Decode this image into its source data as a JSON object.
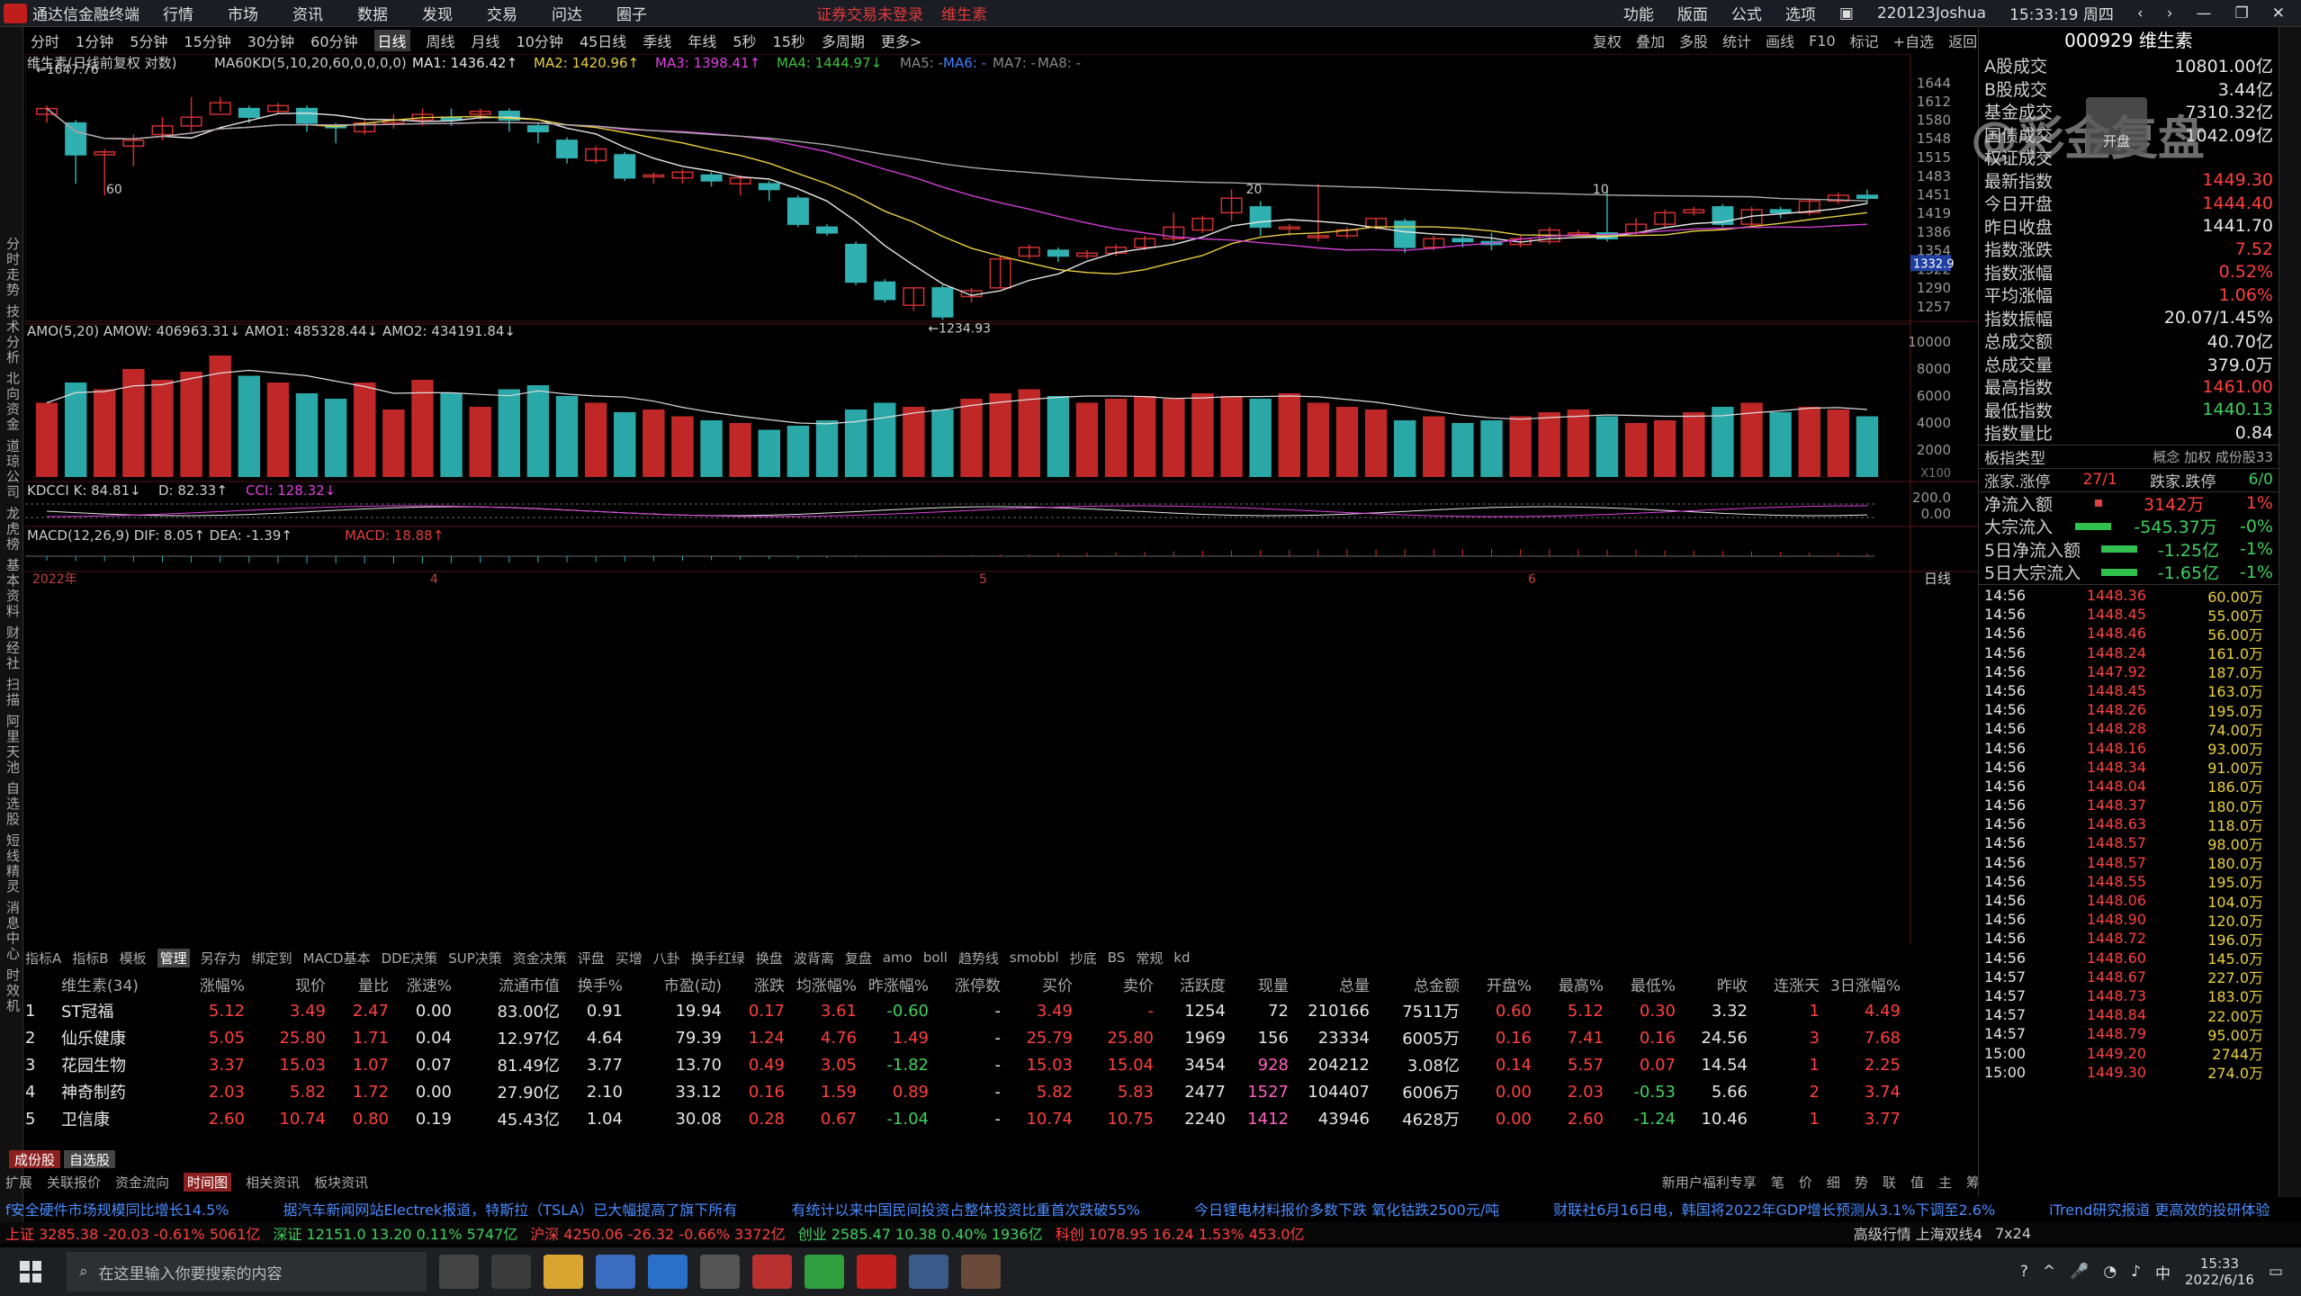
{
  "menubar": {
    "app_name": "通达信金融终端",
    "items": [
      "行情",
      "市场",
      "资讯",
      "数据",
      "发现",
      "交易",
      "问达",
      "圈子"
    ],
    "warning": "证券交易未登录",
    "stock": "维生素",
    "right_items": [
      "功能",
      "版面",
      "公式",
      "选项"
    ],
    "user": "220123Joshua",
    "time": "15:33:19 周四"
  },
  "periodbar": {
    "items": [
      "分时",
      "1分钟",
      "5分钟",
      "15分钟",
      "30分钟",
      "60分钟",
      "日线",
      "周线",
      "月线",
      "10分钟",
      "45日线",
      "季线",
      "年线",
      "5秒",
      "15秒",
      "多周期",
      "更多>"
    ],
    "selected": "日线",
    "tools": [
      "复权",
      "叠加",
      "多股",
      "统计",
      "画线",
      "F10",
      "标记",
      "+自选",
      "返回"
    ]
  },
  "leftstrip": {
    "text": "分时走势 技术分析 北向资金 道琼公司 龙虎榜 基本资料 财经社 扫描 阿里天池 自选股 短线精灵 消息中心 时效机"
  },
  "chart": {
    "legend_main": "维生素(日线前复权 对数)",
    "ma_label": "MA60KD(5,10,20,60,0,0,0,0)",
    "ma1": "MA1: 1436.42↑",
    "ma2": "MA2: 1420.96↑",
    "ma3": "MA3: 1398.41↑",
    "ma4": "MA4: 1444.97↓",
    "ma5": "MA5: -",
    "ma6": "MA6: -",
    "ma7": "MA7: -",
    "ma8": "MA8: -",
    "price_axis": [
      "1644",
      "1612",
      "1580",
      "1548",
      "1515",
      "1483",
      "1451",
      "1419",
      "1386",
      "1354",
      "1322",
      "1290",
      "1257"
    ],
    "high_label": "←1647.76",
    "low_label": "←1234.93",
    "current_marker": "1332.9",
    "ann_60": "60",
    "ann_20": "20",
    "ann_10": "10",
    "vol_legend": "AMO(5,20)  AMOW: 406963.31↓  AMO1: 485328.44↓  AMO2: 434191.84↓",
    "vol_axis": [
      "10000",
      "8000",
      "6000",
      "4000",
      "2000",
      "X100"
    ],
    "kdcci_legend_k": "KDCCI  K: 84.81↓",
    "kdcci_legend_d": "D: 82.33↑",
    "kdcci_legend_cci": "CCI: 128.32↓",
    "kdcci_axis": [
      "200.0",
      "0.00"
    ],
    "macd_legend": "MACD(12,26,9)  DIF: 8.05↑  DEA: -1.39↑",
    "macd_val": "MACD: 18.88↑",
    "date_labels": [
      "2022年",
      "4",
      "5",
      "6"
    ],
    "date_axis_right": "日线"
  },
  "chart_data": {
    "type": "candlestick",
    "title": "维生素(日线前复权 对数)",
    "ylim": [
      1234.93,
      1647.76
    ],
    "candles": [
      [
        1590,
        1600,
        1575,
        1605
      ],
      [
        1575,
        1520,
        1470,
        1580
      ],
      [
        1520,
        1525,
        1450,
        1530
      ],
      [
        1535,
        1545,
        1500,
        1555
      ],
      [
        1555,
        1570,
        1545,
        1585
      ],
      [
        1570,
        1585,
        1560,
        1620
      ],
      [
        1590,
        1610,
        1595,
        1620
      ],
      [
        1600,
        1585,
        1575,
        1605
      ],
      [
        1595,
        1605,
        1590,
        1610
      ],
      [
        1600,
        1575,
        1560,
        1605
      ],
      [
        1570,
        1568,
        1540,
        1575
      ],
      [
        1560,
        1575,
        1555,
        1580
      ],
      [
        1575,
        1580,
        1565,
        1590
      ],
      [
        1580,
        1590,
        1570,
        1600
      ],
      [
        1585,
        1580,
        1570,
        1600
      ],
      [
        1590,
        1595,
        1580,
        1600
      ],
      [
        1595,
        1580,
        1560,
        1600
      ],
      [
        1570,
        1560,
        1540,
        1575
      ],
      [
        1545,
        1515,
        1505,
        1550
      ],
      [
        1510,
        1530,
        1505,
        1535
      ],
      [
        1520,
        1480,
        1475,
        1525
      ],
      [
        1485,
        1485,
        1470,
        1490
      ],
      [
        1480,
        1490,
        1470,
        1495
      ],
      [
        1485,
        1475,
        1465,
        1490
      ],
      [
        1470,
        1480,
        1450,
        1485
      ],
      [
        1470,
        1460,
        1440,
        1475
      ],
      [
        1445,
        1400,
        1395,
        1450
      ],
      [
        1395,
        1385,
        1380,
        1400
      ],
      [
        1365,
        1300,
        1295,
        1370
      ],
      [
        1300,
        1270,
        1265,
        1305
      ],
      [
        1260,
        1290,
        1250,
        1290
      ],
      [
        1290,
        1240,
        1235,
        1295
      ],
      [
        1275,
        1285,
        1265,
        1290
      ],
      [
        1290,
        1340,
        1290,
        1345
      ],
      [
        1345,
        1360,
        1340,
        1365
      ],
      [
        1355,
        1345,
        1335,
        1360
      ],
      [
        1345,
        1350,
        1340,
        1355
      ],
      [
        1350,
        1360,
        1345,
        1365
      ],
      [
        1360,
        1375,
        1355,
        1380
      ],
      [
        1375,
        1395,
        1370,
        1420
      ],
      [
        1390,
        1410,
        1385,
        1415
      ],
      [
        1420,
        1445,
        1405,
        1460
      ],
      [
        1430,
        1395,
        1380,
        1440
      ],
      [
        1395,
        1395,
        1380,
        1400
      ],
      [
        1380,
        1380,
        1370,
        1470
      ],
      [
        1380,
        1390,
        1375,
        1395
      ],
      [
        1395,
        1410,
        1390,
        1410
      ],
      [
        1405,
        1360,
        1350,
        1410
      ],
      [
        1360,
        1375,
        1355,
        1380
      ],
      [
        1375,
        1370,
        1360,
        1380
      ],
      [
        1370,
        1365,
        1355,
        1385
      ],
      [
        1365,
        1375,
        1360,
        1380
      ],
      [
        1370,
        1390,
        1365,
        1395
      ],
      [
        1385,
        1385,
        1380,
        1390
      ],
      [
        1385,
        1375,
        1370,
        1460
      ],
      [
        1385,
        1400,
        1380,
        1410
      ],
      [
        1400,
        1420,
        1395,
        1425
      ],
      [
        1420,
        1425,
        1415,
        1430
      ],
      [
        1430,
        1400,
        1395,
        1435
      ],
      [
        1400,
        1425,
        1395,
        1430
      ],
      [
        1425,
        1420,
        1410,
        1430
      ],
      [
        1420,
        1440,
        1415,
        1445
      ],
      [
        1440,
        1450,
        1435,
        1455
      ],
      [
        1450,
        1445,
        1435,
        1460
      ]
    ],
    "volume": [
      55,
      70,
      65,
      80,
      72,
      78,
      90,
      75,
      70,
      62,
      58,
      70,
      50,
      72,
      62,
      52,
      65,
      68,
      60,
      55,
      48,
      50,
      45,
      42,
      40,
      35,
      38,
      42,
      50,
      55,
      52,
      50,
      58,
      62,
      65,
      60,
      55,
      58,
      60,
      58,
      62,
      60,
      58,
      62,
      55,
      52,
      50,
      42,
      45,
      40,
      42,
      45,
      48,
      50,
      45,
      40,
      42,
      48,
      52,
      55,
      48,
      52,
      50,
      45
    ],
    "volume_colors": "rise=red,fall=teal"
  },
  "indic_tabs": [
    "指标A",
    "指标B",
    "模板",
    "管理",
    "另存为",
    "绑定到",
    "MACD基本",
    "DDE决策",
    "SUP决策",
    "资金决策",
    "评盘",
    "买增",
    "八卦",
    "换手红绿",
    "换盘",
    "波背离",
    "复盘",
    "amo",
    "boll",
    "趋势线",
    "smobbl",
    "抄底",
    "BS",
    "常规",
    "kd"
  ],
  "indic_selected": "管理",
  "table": {
    "group": "维生素(34)",
    "headers": [
      "",
      "维生素(34)",
      "涨幅%",
      "现价",
      "量比",
      "涨速%",
      "流通市值",
      "换手%",
      "市盈(动)",
      "涨跌",
      "均涨幅%",
      "昨涨幅%",
      "涨停数",
      "买价",
      "卖价",
      "活跃度",
      "现量",
      "总量",
      "总金额",
      "开盘%",
      "最高%",
      "最低%",
      "昨收",
      "连涨天",
      "3日涨幅%"
    ],
    "rows": [
      [
        "1",
        "ST冠福",
        "5.12",
        "3.49",
        "2.47",
        "0.00",
        "83.00亿",
        "0.91",
        "19.94",
        "0.17",
        "3.61",
        "-0.60",
        "-",
        "3.49",
        "-",
        "1254",
        "72",
        "210166",
        "7511万",
        "0.60",
        "5.12",
        "0.30",
        "3.32",
        "1",
        "4.49"
      ],
      [
        "2",
        "仙乐健康",
        "5.05",
        "25.80",
        "1.71",
        "0.04",
        "12.97亿",
        "4.64",
        "79.39",
        "1.24",
        "4.76",
        "1.49",
        "-",
        "25.79",
        "25.80",
        "1969",
        "156",
        "23334",
        "6005万",
        "0.16",
        "7.41",
        "0.16",
        "24.56",
        "3",
        "7.68"
      ],
      [
        "3",
        "花园生物",
        "3.37",
        "15.03",
        "1.07",
        "0.07",
        "81.49亿",
        "3.77",
        "13.70",
        "0.49",
        "3.05",
        "-1.82",
        "-",
        "15.03",
        "15.04",
        "3454",
        "928",
        "204212",
        "3.08亿",
        "0.14",
        "5.57",
        "0.07",
        "14.54",
        "1",
        "2.25"
      ],
      [
        "4",
        "神奇制药",
        "2.03",
        "5.82",
        "1.72",
        "0.00",
        "27.90亿",
        "2.10",
        "33.12",
        "0.16",
        "1.59",
        "0.89",
        "-",
        "5.82",
        "5.83",
        "2477",
        "1527",
        "104407",
        "6006万",
        "0.00",
        "2.03",
        "-0.53",
        "5.66",
        "2",
        "3.74"
      ],
      [
        "5",
        "卫信康",
        "2.60",
        "10.74",
        "0.80",
        "0.19",
        "45.43亿",
        "1.04",
        "30.08",
        "0.28",
        "0.67",
        "-1.04",
        "-",
        "10.74",
        "10.75",
        "2240",
        "1412",
        "43946",
        "4628万",
        "0.00",
        "2.60",
        "-1.24",
        "10.46",
        "1",
        "3.77"
      ]
    ]
  },
  "tabs2": [
    "成份股",
    "自选股"
  ],
  "bottom_tabs": [
    "扩展",
    "关联报价",
    "资金流向",
    "时间图",
    "相关资讯",
    "板块资讯"
  ],
  "bottom_tabs_right": [
    "新用户福利专享",
    "笔",
    "价",
    "细",
    "势",
    "联",
    "值",
    "主",
    "筹"
  ],
  "ticker": [
    "f安全硬件市场规模同比增长14.5%",
    "据汽车新闻网站Electrek报道，特斯拉（TSLA）已大幅提高了旗下所有",
    "有统计以来中国民间投资占整体投资比重首次跌破55%",
    "今日锂电材料报价多数下跌 氧化钴跌2500元/吨",
    "财联社6月16日电，韩国将2022年GDP增长预测从3.1%下调至2.6%",
    "iTrend研究报道 更高效的投研体验"
  ],
  "statusbar": {
    "sh": "上证 3285.38 -20.03 -0.61% 5061亿",
    "sz": "深证 12151.0 13.20 0.11% 5747亿",
    "hs": "沪深 4250.06 -26.32 -0.66% 3372亿",
    "cy": "创业 2585.47 10.38 0.40% 1936亿",
    "kc": "科创 1078.95 16.24 1.53% 453.0亿",
    "right": "高级行情 上海双线4",
    "clock": "7x24"
  },
  "rpanel": {
    "title": "000929 维生素",
    "kv": [
      [
        "A股成交",
        "10801.00亿"
      ],
      [
        "B股成交",
        "3.44亿"
      ],
      [
        "基金成交",
        "7310.32亿"
      ],
      [
        "国债成交",
        "1042.09亿"
      ],
      [
        "权证成交",
        ""
      ],
      [
        "最新指数",
        "1449.30"
      ],
      [
        "今日开盘",
        "1444.40"
      ],
      [
        "昨日收盘",
        "1441.70"
      ],
      [
        "指数涨跌",
        "7.52"
      ],
      [
        "指数涨幅",
        "0.52%"
      ],
      [
        "平均涨幅",
        "1.06%"
      ],
      [
        "指数振幅",
        "20.07/1.45%"
      ],
      [
        "总成交额",
        "40.70亿"
      ],
      [
        "总成交量",
        "379.0万"
      ],
      [
        "最高指数",
        "1461.00"
      ],
      [
        "最低指数",
        "1440.13"
      ],
      [
        "指数量比",
        "0.84"
      ]
    ],
    "kv_colors": [
      "white",
      "white",
      "white",
      "white",
      "white",
      "red",
      "red",
      "white",
      "red",
      "red",
      "red",
      "white",
      "white",
      "white",
      "red",
      "green",
      "white"
    ],
    "sec1_left": "板指类型",
    "sec1_right": "概念 加权 成份股33",
    "sec2_left": "涨家.涨停",
    "sec2_mid": "27/1",
    "sec2_right_label": "跌家.跌停",
    "sec2_right": "6/0",
    "flows": [
      [
        "净流入额",
        "3142万",
        "1%"
      ],
      [
        "大宗流入",
        "-545.37万",
        "-0%"
      ],
      [
        "5日净流入额",
        "-1.25亿",
        "-1%"
      ],
      [
        "5日大宗流入",
        "-1.65亿",
        "-1%"
      ]
    ],
    "ticks": [
      [
        "14:56",
        "1448.36",
        "60.00万"
      ],
      [
        "14:56",
        "1448.45",
        "55.00万"
      ],
      [
        "14:56",
        "1448.46",
        "56.00万"
      ],
      [
        "14:56",
        "1448.24",
        "161.0万"
      ],
      [
        "14:56",
        "1447.92",
        "187.0万"
      ],
      [
        "14:56",
        "1448.45",
        "163.0万"
      ],
      [
        "14:56",
        "1448.26",
        "195.0万"
      ],
      [
        "14:56",
        "1448.28",
        "74.00万"
      ],
      [
        "14:56",
        "1448.16",
        "93.00万"
      ],
      [
        "14:56",
        "1448.34",
        "91.00万"
      ],
      [
        "14:56",
        "1448.04",
        "186.0万"
      ],
      [
        "14:56",
        "1448.37",
        "180.0万"
      ],
      [
        "14:56",
        "1448.63",
        "118.0万"
      ],
      [
        "14:56",
        "1448.57",
        "98.00万"
      ],
      [
        "14:56",
        "1448.57",
        "180.0万"
      ],
      [
        "14:56",
        "1448.55",
        "195.0万"
      ],
      [
        "14:56",
        "1448.06",
        "104.0万"
      ],
      [
        "14:56",
        "1448.90",
        "120.0万"
      ],
      [
        "14:56",
        "1448.72",
        "196.0万"
      ],
      [
        "14:56",
        "1448.60",
        "145.0万"
      ],
      [
        "14:57",
        "1448.67",
        "227.0万"
      ],
      [
        "14:57",
        "1448.73",
        "183.0万"
      ],
      [
        "14:57",
        "1448.84",
        "22.00万"
      ],
      [
        "14:57",
        "1448.79",
        "95.00万"
      ],
      [
        "15:00",
        "1449.20",
        "2744万"
      ],
      [
        "15:00",
        "1449.30",
        "274.0万"
      ]
    ]
  },
  "watermark": "@彩金复盘",
  "watermark_btn": "开盘",
  "taskbar": {
    "search_placeholder": "在这里输入你要搜索的内容",
    "time": "15:33",
    "date": "2022/6/16",
    "ime": "中"
  }
}
